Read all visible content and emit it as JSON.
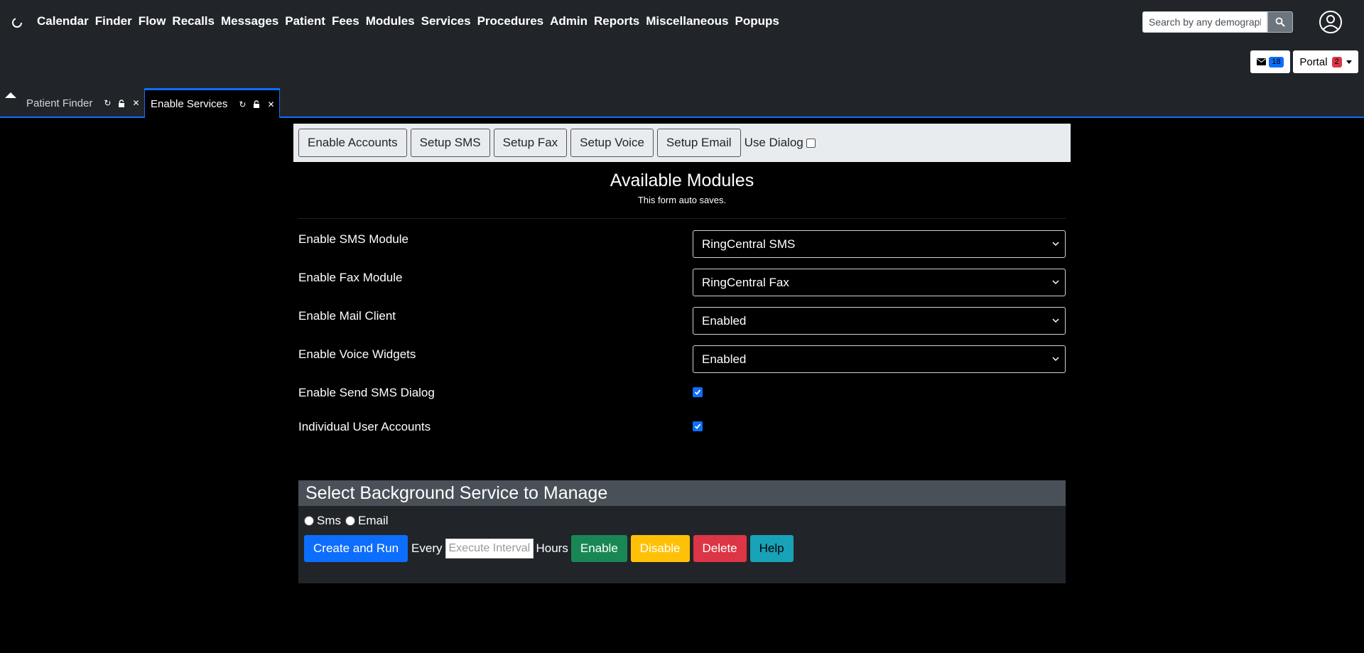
{
  "menu": [
    "Calendar",
    "Finder",
    "Flow",
    "Recalls",
    "Messages",
    "Patient",
    "Fees",
    "Modules",
    "Services",
    "Procedures",
    "Admin",
    "Reports",
    "Miscellaneous",
    "Popups"
  ],
  "search": {
    "placeholder": "Search by any demographics"
  },
  "messages": {
    "count": "18"
  },
  "portal": {
    "label": "Portal",
    "count": "2"
  },
  "tabs": [
    {
      "label": "Patient Finder"
    },
    {
      "label": "Enable Services"
    }
  ],
  "toolbar": {
    "buttons": [
      "Enable Accounts",
      "Setup SMS",
      "Setup Fax",
      "Setup Voice",
      "Setup Email"
    ],
    "use_dialog_label": "Use Dialog"
  },
  "header": {
    "title": "Available Modules",
    "subtitle": "This form auto saves."
  },
  "settings": [
    {
      "label": "Enable SMS Module",
      "value": "RingCentral SMS"
    },
    {
      "label": "Enable Fax Module",
      "value": "RingCentral Fax"
    },
    {
      "label": "Enable Mail Client",
      "value": "Enabled"
    },
    {
      "label": "Enable Voice Widgets",
      "value": "Enabled"
    },
    {
      "label": "Enable Send SMS Dialog",
      "checked": true
    },
    {
      "label": "Individual User Accounts",
      "checked": true
    }
  ],
  "background_service": {
    "title": "Select Background Service to Manage",
    "radio_sms": "Sms",
    "radio_email": "Email",
    "create_btn": "Create and Run",
    "every_label": "Every",
    "interval_placeholder": "Execute Interval",
    "hours_label": "Hours",
    "enable_btn": "Enable",
    "disable_btn": "Disable",
    "delete_btn": "Delete",
    "help_btn": "Help"
  },
  "colors": {
    "accent": "#0d6efd",
    "header_bg": "#212529",
    "success": "#198754",
    "warning": "#ffc107",
    "danger": "#dc3545",
    "info": "#17a2b8"
  }
}
